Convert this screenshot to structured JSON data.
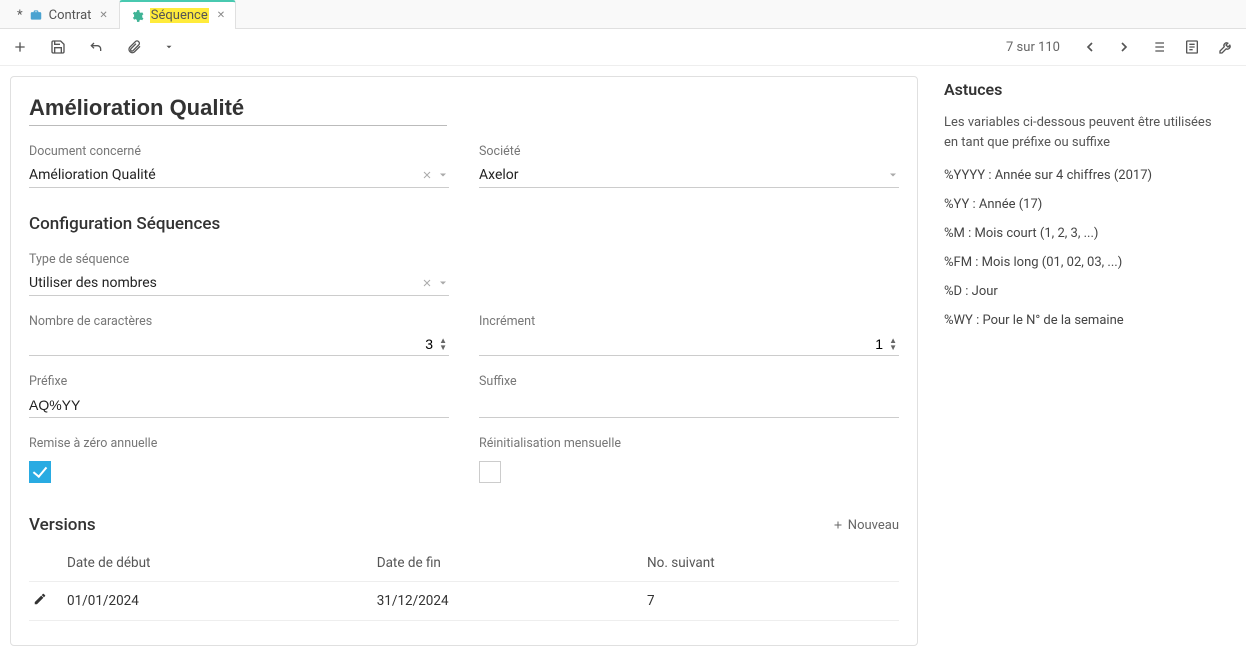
{
  "tabs": [
    {
      "label": "Contrat",
      "prefix": "*",
      "active": false
    },
    {
      "label": "Séquence",
      "active": true,
      "highlight": true
    }
  ],
  "toolbar": {
    "pager": "7 sur 110"
  },
  "record": {
    "title": "Amélioration Qualité",
    "document_label": "Document concerné",
    "document_value": "Amélioration Qualité",
    "company_label": "Société",
    "company_value": "Axelor",
    "config_section": "Configuration Séquences",
    "seqtype_label": "Type de séquence",
    "seqtype_value": "Utiliser des nombres",
    "nbchar_label": "Nombre de caractères",
    "nbchar_value": "3",
    "increment_label": "Incrément",
    "increment_value": "1",
    "prefix_label": "Préfixe",
    "prefix_value": "AQ%YY",
    "suffix_label": "Suffixe",
    "suffix_value": "",
    "yearly_label": "Remise à zéro annuelle",
    "monthly_label": "Réinitialisation mensuelle",
    "versions_title": "Versions",
    "btn_new": "Nouveau",
    "col_start": "Date de début",
    "col_end": "Date de fin",
    "col_next": "No. suivant",
    "versions": [
      {
        "start": "01/01/2024",
        "end": "31/12/2024",
        "next": "7"
      }
    ]
  },
  "hints": {
    "title": "Astuces",
    "intro": "Les variables ci-dessous peuvent être utilisées en tant que préfixe ou suffixe",
    "lines": [
      "%YYYY : Année sur 4 chiffres (2017)",
      "%YY : Année (17)",
      "%M : Mois court (1, 2, 3, ...)",
      "%FM : Mois long (01, 02, 03, ...)",
      "%D : Jour",
      "%WY : Pour le N° de la semaine"
    ]
  }
}
